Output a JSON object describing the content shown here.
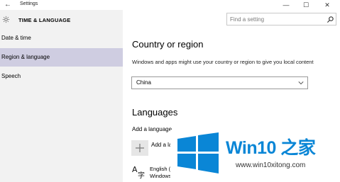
{
  "window": {
    "title": "Settings",
    "back_icon": "back-arrow-icon",
    "minimize_glyph": "—",
    "maximize_glyph": "☐",
    "close_glyph": "✕"
  },
  "sidebar": {
    "section_title": "TIME & LANGUAGE",
    "section_icon": "gear-icon",
    "items": [
      {
        "label": "Date & time",
        "selected": false
      },
      {
        "label": "Region & language",
        "selected": true
      },
      {
        "label": "Speech",
        "selected": false
      }
    ]
  },
  "search": {
    "placeholder": "Find a setting",
    "icon": "search-icon"
  },
  "country": {
    "heading": "Country or region",
    "description": "Windows and apps might use your country or region to give you local content",
    "selected": "China"
  },
  "languages": {
    "heading": "Languages",
    "add_label": "Add a language",
    "add_button_label": "Add a la",
    "items": [
      {
        "name": "English (",
        "sub": "Windows",
        "icon": "language-icon"
      }
    ]
  },
  "watermark": {
    "title": "Win10 之家",
    "url": "www.win10xitong.com"
  },
  "colors": {
    "accent": "#0a86d6",
    "selected_nav": "#cfcde1",
    "sidebar_bg": "#f2f2f2"
  }
}
